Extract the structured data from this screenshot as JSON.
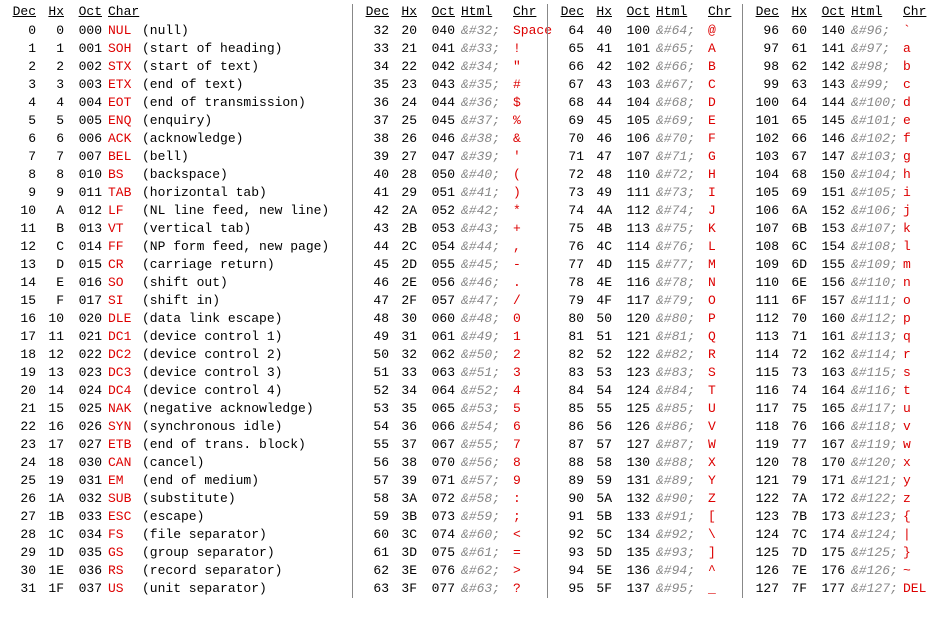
{
  "headers": {
    "dec": "Dec",
    "hx": "Hx",
    "oct": "Oct",
    "char": "Char",
    "html": "Html",
    "chr": "Chr"
  },
  "col1": [
    {
      "dec": "0",
      "hx": "0",
      "oct": "000",
      "sym": "NUL",
      "desc": "(null)"
    },
    {
      "dec": "1",
      "hx": "1",
      "oct": "001",
      "sym": "SOH",
      "desc": "(start of heading)"
    },
    {
      "dec": "2",
      "hx": "2",
      "oct": "002",
      "sym": "STX",
      "desc": "(start of text)"
    },
    {
      "dec": "3",
      "hx": "3",
      "oct": "003",
      "sym": "ETX",
      "desc": "(end of text)"
    },
    {
      "dec": "4",
      "hx": "4",
      "oct": "004",
      "sym": "EOT",
      "desc": "(end of transmission)"
    },
    {
      "dec": "5",
      "hx": "5",
      "oct": "005",
      "sym": "ENQ",
      "desc": "(enquiry)"
    },
    {
      "dec": "6",
      "hx": "6",
      "oct": "006",
      "sym": "ACK",
      "desc": "(acknowledge)"
    },
    {
      "dec": "7",
      "hx": "7",
      "oct": "007",
      "sym": "BEL",
      "desc": "(bell)"
    },
    {
      "dec": "8",
      "hx": "8",
      "oct": "010",
      "sym": "BS",
      "desc": "(backspace)"
    },
    {
      "dec": "9",
      "hx": "9",
      "oct": "011",
      "sym": "TAB",
      "desc": "(horizontal tab)"
    },
    {
      "dec": "10",
      "hx": "A",
      "oct": "012",
      "sym": "LF",
      "desc": "(NL line feed, new line)"
    },
    {
      "dec": "11",
      "hx": "B",
      "oct": "013",
      "sym": "VT",
      "desc": "(vertical tab)"
    },
    {
      "dec": "12",
      "hx": "C",
      "oct": "014",
      "sym": "FF",
      "desc": "(NP form feed, new page)"
    },
    {
      "dec": "13",
      "hx": "D",
      "oct": "015",
      "sym": "CR",
      "desc": "(carriage return)"
    },
    {
      "dec": "14",
      "hx": "E",
      "oct": "016",
      "sym": "SO",
      "desc": "(shift out)"
    },
    {
      "dec": "15",
      "hx": "F",
      "oct": "017",
      "sym": "SI",
      "desc": "(shift in)"
    },
    {
      "dec": "16",
      "hx": "10",
      "oct": "020",
      "sym": "DLE",
      "desc": "(data link escape)"
    },
    {
      "dec": "17",
      "hx": "11",
      "oct": "021",
      "sym": "DC1",
      "desc": "(device control 1)"
    },
    {
      "dec": "18",
      "hx": "12",
      "oct": "022",
      "sym": "DC2",
      "desc": "(device control 2)"
    },
    {
      "dec": "19",
      "hx": "13",
      "oct": "023",
      "sym": "DC3",
      "desc": "(device control 3)"
    },
    {
      "dec": "20",
      "hx": "14",
      "oct": "024",
      "sym": "DC4",
      "desc": "(device control 4)"
    },
    {
      "dec": "21",
      "hx": "15",
      "oct": "025",
      "sym": "NAK",
      "desc": "(negative acknowledge)"
    },
    {
      "dec": "22",
      "hx": "16",
      "oct": "026",
      "sym": "SYN",
      "desc": "(synchronous idle)"
    },
    {
      "dec": "23",
      "hx": "17",
      "oct": "027",
      "sym": "ETB",
      "desc": "(end of trans. block)"
    },
    {
      "dec": "24",
      "hx": "18",
      "oct": "030",
      "sym": "CAN",
      "desc": "(cancel)"
    },
    {
      "dec": "25",
      "hx": "19",
      "oct": "031",
      "sym": "EM",
      "desc": "(end of medium)"
    },
    {
      "dec": "26",
      "hx": "1A",
      "oct": "032",
      "sym": "SUB",
      "desc": "(substitute)"
    },
    {
      "dec": "27",
      "hx": "1B",
      "oct": "033",
      "sym": "ESC",
      "desc": "(escape)"
    },
    {
      "dec": "28",
      "hx": "1C",
      "oct": "034",
      "sym": "FS",
      "desc": "(file separator)"
    },
    {
      "dec": "29",
      "hx": "1D",
      "oct": "035",
      "sym": "GS",
      "desc": "(group separator)"
    },
    {
      "dec": "30",
      "hx": "1E",
      "oct": "036",
      "sym": "RS",
      "desc": "(record separator)"
    },
    {
      "dec": "31",
      "hx": "1F",
      "oct": "037",
      "sym": "US",
      "desc": "(unit separator)"
    }
  ],
  "col2": [
    {
      "dec": "32",
      "hx": "20",
      "oct": "040",
      "html": "&#32;",
      "chr": "Space"
    },
    {
      "dec": "33",
      "hx": "21",
      "oct": "041",
      "html": "&#33;",
      "chr": "!"
    },
    {
      "dec": "34",
      "hx": "22",
      "oct": "042",
      "html": "&#34;",
      "chr": "\""
    },
    {
      "dec": "35",
      "hx": "23",
      "oct": "043",
      "html": "&#35;",
      "chr": "#"
    },
    {
      "dec": "36",
      "hx": "24",
      "oct": "044",
      "html": "&#36;",
      "chr": "$"
    },
    {
      "dec": "37",
      "hx": "25",
      "oct": "045",
      "html": "&#37;",
      "chr": "%"
    },
    {
      "dec": "38",
      "hx": "26",
      "oct": "046",
      "html": "&#38;",
      "chr": "&"
    },
    {
      "dec": "39",
      "hx": "27",
      "oct": "047",
      "html": "&#39;",
      "chr": "'"
    },
    {
      "dec": "40",
      "hx": "28",
      "oct": "050",
      "html": "&#40;",
      "chr": "("
    },
    {
      "dec": "41",
      "hx": "29",
      "oct": "051",
      "html": "&#41;",
      "chr": ")"
    },
    {
      "dec": "42",
      "hx": "2A",
      "oct": "052",
      "html": "&#42;",
      "chr": "*"
    },
    {
      "dec": "43",
      "hx": "2B",
      "oct": "053",
      "html": "&#43;",
      "chr": "+"
    },
    {
      "dec": "44",
      "hx": "2C",
      "oct": "054",
      "html": "&#44;",
      "chr": ","
    },
    {
      "dec": "45",
      "hx": "2D",
      "oct": "055",
      "html": "&#45;",
      "chr": "-"
    },
    {
      "dec": "46",
      "hx": "2E",
      "oct": "056",
      "html": "&#46;",
      "chr": "."
    },
    {
      "dec": "47",
      "hx": "2F",
      "oct": "057",
      "html": "&#47;",
      "chr": "/"
    },
    {
      "dec": "48",
      "hx": "30",
      "oct": "060",
      "html": "&#48;",
      "chr": "0"
    },
    {
      "dec": "49",
      "hx": "31",
      "oct": "061",
      "html": "&#49;",
      "chr": "1"
    },
    {
      "dec": "50",
      "hx": "32",
      "oct": "062",
      "html": "&#50;",
      "chr": "2"
    },
    {
      "dec": "51",
      "hx": "33",
      "oct": "063",
      "html": "&#51;",
      "chr": "3"
    },
    {
      "dec": "52",
      "hx": "34",
      "oct": "064",
      "html": "&#52;",
      "chr": "4"
    },
    {
      "dec": "53",
      "hx": "35",
      "oct": "065",
      "html": "&#53;",
      "chr": "5"
    },
    {
      "dec": "54",
      "hx": "36",
      "oct": "066",
      "html": "&#54;",
      "chr": "6"
    },
    {
      "dec": "55",
      "hx": "37",
      "oct": "067",
      "html": "&#55;",
      "chr": "7"
    },
    {
      "dec": "56",
      "hx": "38",
      "oct": "070",
      "html": "&#56;",
      "chr": "8"
    },
    {
      "dec": "57",
      "hx": "39",
      "oct": "071",
      "html": "&#57;",
      "chr": "9"
    },
    {
      "dec": "58",
      "hx": "3A",
      "oct": "072",
      "html": "&#58;",
      "chr": ":"
    },
    {
      "dec": "59",
      "hx": "3B",
      "oct": "073",
      "html": "&#59;",
      "chr": ";"
    },
    {
      "dec": "60",
      "hx": "3C",
      "oct": "074",
      "html": "&#60;",
      "chr": "<"
    },
    {
      "dec": "61",
      "hx": "3D",
      "oct": "075",
      "html": "&#61;",
      "chr": "="
    },
    {
      "dec": "62",
      "hx": "3E",
      "oct": "076",
      "html": "&#62;",
      "chr": ">"
    },
    {
      "dec": "63",
      "hx": "3F",
      "oct": "077",
      "html": "&#63;",
      "chr": "?"
    }
  ],
  "col3": [
    {
      "dec": "64",
      "hx": "40",
      "oct": "100",
      "html": "&#64;",
      "chr": "@"
    },
    {
      "dec": "65",
      "hx": "41",
      "oct": "101",
      "html": "&#65;",
      "chr": "A"
    },
    {
      "dec": "66",
      "hx": "42",
      "oct": "102",
      "html": "&#66;",
      "chr": "B"
    },
    {
      "dec": "67",
      "hx": "43",
      "oct": "103",
      "html": "&#67;",
      "chr": "C"
    },
    {
      "dec": "68",
      "hx": "44",
      "oct": "104",
      "html": "&#68;",
      "chr": "D"
    },
    {
      "dec": "69",
      "hx": "45",
      "oct": "105",
      "html": "&#69;",
      "chr": "E"
    },
    {
      "dec": "70",
      "hx": "46",
      "oct": "106",
      "html": "&#70;",
      "chr": "F"
    },
    {
      "dec": "71",
      "hx": "47",
      "oct": "107",
      "html": "&#71;",
      "chr": "G"
    },
    {
      "dec": "72",
      "hx": "48",
      "oct": "110",
      "html": "&#72;",
      "chr": "H"
    },
    {
      "dec": "73",
      "hx": "49",
      "oct": "111",
      "html": "&#73;",
      "chr": "I"
    },
    {
      "dec": "74",
      "hx": "4A",
      "oct": "112",
      "html": "&#74;",
      "chr": "J"
    },
    {
      "dec": "75",
      "hx": "4B",
      "oct": "113",
      "html": "&#75;",
      "chr": "K"
    },
    {
      "dec": "76",
      "hx": "4C",
      "oct": "114",
      "html": "&#76;",
      "chr": "L"
    },
    {
      "dec": "77",
      "hx": "4D",
      "oct": "115",
      "html": "&#77;",
      "chr": "M"
    },
    {
      "dec": "78",
      "hx": "4E",
      "oct": "116",
      "html": "&#78;",
      "chr": "N"
    },
    {
      "dec": "79",
      "hx": "4F",
      "oct": "117",
      "html": "&#79;",
      "chr": "O"
    },
    {
      "dec": "80",
      "hx": "50",
      "oct": "120",
      "html": "&#80;",
      "chr": "P"
    },
    {
      "dec": "81",
      "hx": "51",
      "oct": "121",
      "html": "&#81;",
      "chr": "Q"
    },
    {
      "dec": "82",
      "hx": "52",
      "oct": "122",
      "html": "&#82;",
      "chr": "R"
    },
    {
      "dec": "83",
      "hx": "53",
      "oct": "123",
      "html": "&#83;",
      "chr": "S"
    },
    {
      "dec": "84",
      "hx": "54",
      "oct": "124",
      "html": "&#84;",
      "chr": "T"
    },
    {
      "dec": "85",
      "hx": "55",
      "oct": "125",
      "html": "&#85;",
      "chr": "U"
    },
    {
      "dec": "86",
      "hx": "56",
      "oct": "126",
      "html": "&#86;",
      "chr": "V"
    },
    {
      "dec": "87",
      "hx": "57",
      "oct": "127",
      "html": "&#87;",
      "chr": "W"
    },
    {
      "dec": "88",
      "hx": "58",
      "oct": "130",
      "html": "&#88;",
      "chr": "X"
    },
    {
      "dec": "89",
      "hx": "59",
      "oct": "131",
      "html": "&#89;",
      "chr": "Y"
    },
    {
      "dec": "90",
      "hx": "5A",
      "oct": "132",
      "html": "&#90;",
      "chr": "Z"
    },
    {
      "dec": "91",
      "hx": "5B",
      "oct": "133",
      "html": "&#91;",
      "chr": "["
    },
    {
      "dec": "92",
      "hx": "5C",
      "oct": "134",
      "html": "&#92;",
      "chr": "\\"
    },
    {
      "dec": "93",
      "hx": "5D",
      "oct": "135",
      "html": "&#93;",
      "chr": "]"
    },
    {
      "dec": "94",
      "hx": "5E",
      "oct": "136",
      "html": "&#94;",
      "chr": "^"
    },
    {
      "dec": "95",
      "hx": "5F",
      "oct": "137",
      "html": "&#95;",
      "chr": "_"
    }
  ],
  "col4": [
    {
      "dec": "96",
      "hx": "60",
      "oct": "140",
      "html": "&#96;",
      "chr": "`"
    },
    {
      "dec": "97",
      "hx": "61",
      "oct": "141",
      "html": "&#97;",
      "chr": "a"
    },
    {
      "dec": "98",
      "hx": "62",
      "oct": "142",
      "html": "&#98;",
      "chr": "b"
    },
    {
      "dec": "99",
      "hx": "63",
      "oct": "143",
      "html": "&#99;",
      "chr": "c"
    },
    {
      "dec": "100",
      "hx": "64",
      "oct": "144",
      "html": "&#100;",
      "chr": "d"
    },
    {
      "dec": "101",
      "hx": "65",
      "oct": "145",
      "html": "&#101;",
      "chr": "e"
    },
    {
      "dec": "102",
      "hx": "66",
      "oct": "146",
      "html": "&#102;",
      "chr": "f"
    },
    {
      "dec": "103",
      "hx": "67",
      "oct": "147",
      "html": "&#103;",
      "chr": "g"
    },
    {
      "dec": "104",
      "hx": "68",
      "oct": "150",
      "html": "&#104;",
      "chr": "h"
    },
    {
      "dec": "105",
      "hx": "69",
      "oct": "151",
      "html": "&#105;",
      "chr": "i"
    },
    {
      "dec": "106",
      "hx": "6A",
      "oct": "152",
      "html": "&#106;",
      "chr": "j"
    },
    {
      "dec": "107",
      "hx": "6B",
      "oct": "153",
      "html": "&#107;",
      "chr": "k"
    },
    {
      "dec": "108",
      "hx": "6C",
      "oct": "154",
      "html": "&#108;",
      "chr": "l"
    },
    {
      "dec": "109",
      "hx": "6D",
      "oct": "155",
      "html": "&#109;",
      "chr": "m"
    },
    {
      "dec": "110",
      "hx": "6E",
      "oct": "156",
      "html": "&#110;",
      "chr": "n"
    },
    {
      "dec": "111",
      "hx": "6F",
      "oct": "157",
      "html": "&#111;",
      "chr": "o"
    },
    {
      "dec": "112",
      "hx": "70",
      "oct": "160",
      "html": "&#112;",
      "chr": "p"
    },
    {
      "dec": "113",
      "hx": "71",
      "oct": "161",
      "html": "&#113;",
      "chr": "q"
    },
    {
      "dec": "114",
      "hx": "72",
      "oct": "162",
      "html": "&#114;",
      "chr": "r"
    },
    {
      "dec": "115",
      "hx": "73",
      "oct": "163",
      "html": "&#115;",
      "chr": "s"
    },
    {
      "dec": "116",
      "hx": "74",
      "oct": "164",
      "html": "&#116;",
      "chr": "t"
    },
    {
      "dec": "117",
      "hx": "75",
      "oct": "165",
      "html": "&#117;",
      "chr": "u"
    },
    {
      "dec": "118",
      "hx": "76",
      "oct": "166",
      "html": "&#118;",
      "chr": "v"
    },
    {
      "dec": "119",
      "hx": "77",
      "oct": "167",
      "html": "&#119;",
      "chr": "w"
    },
    {
      "dec": "120",
      "hx": "78",
      "oct": "170",
      "html": "&#120;",
      "chr": "x"
    },
    {
      "dec": "121",
      "hx": "79",
      "oct": "171",
      "html": "&#121;",
      "chr": "y"
    },
    {
      "dec": "122",
      "hx": "7A",
      "oct": "172",
      "html": "&#122;",
      "chr": "z"
    },
    {
      "dec": "123",
      "hx": "7B",
      "oct": "173",
      "html": "&#123;",
      "chr": "{"
    },
    {
      "dec": "124",
      "hx": "7C",
      "oct": "174",
      "html": "&#124;",
      "chr": "|"
    },
    {
      "dec": "125",
      "hx": "7D",
      "oct": "175",
      "html": "&#125;",
      "chr": "}"
    },
    {
      "dec": "126",
      "hx": "7E",
      "oct": "176",
      "html": "&#126;",
      "chr": "~"
    },
    {
      "dec": "127",
      "hx": "7F",
      "oct": "177",
      "html": "&#127;",
      "chr": "DEL"
    }
  ]
}
